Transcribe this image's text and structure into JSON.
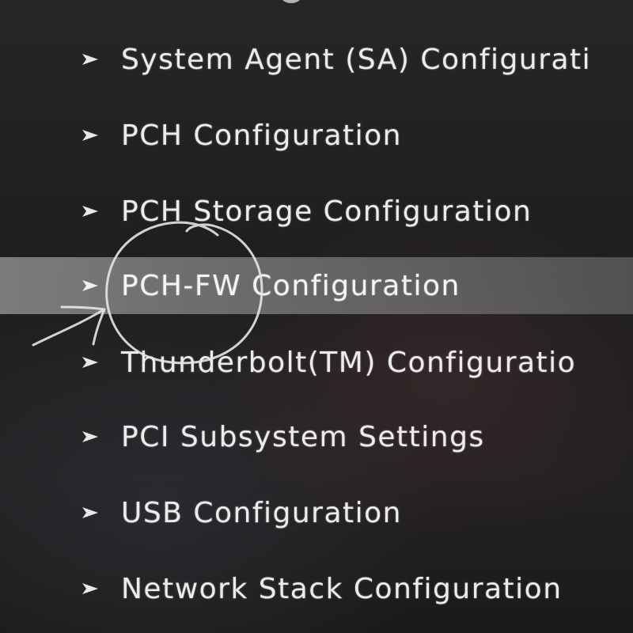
{
  "menu": {
    "items": [
      {
        "label": "System Agent (SA) Configurati",
        "selected": false
      },
      {
        "label": "PCH Configuration",
        "selected": false
      },
      {
        "label": "PCH Storage Configuration",
        "selected": false
      },
      {
        "label": "PCH-FW Configuration",
        "selected": true
      },
      {
        "label": "Thunderbolt(TM) Configuratio",
        "selected": false
      },
      {
        "label": "PCI Subsystem Settings",
        "selected": false
      },
      {
        "label": "USB Configuration",
        "selected": false
      },
      {
        "label": "Network Stack Configuration",
        "selected": false
      }
    ]
  },
  "icons": {
    "item_arrow": "submenu-arrow-icon",
    "annotation": "hand-drawn-circle-and-arrow"
  },
  "colors": {
    "background": "#1e1e1f",
    "text": "#ececec",
    "selection_bar": "#8c8c8c",
    "annotation_ink": "#e6e6e6"
  }
}
